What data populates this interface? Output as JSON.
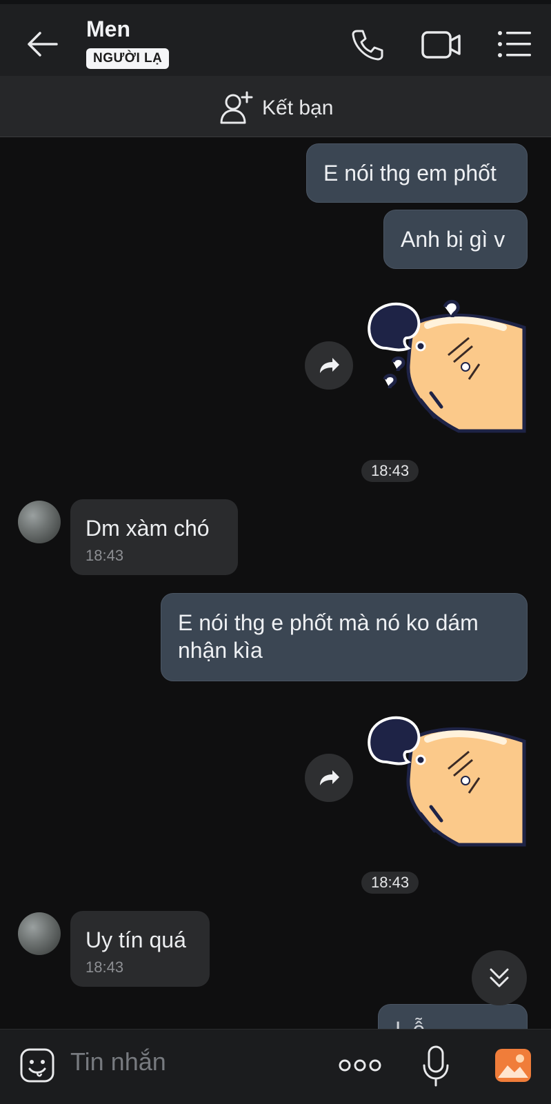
{
  "header": {
    "title": "Men",
    "badge": "NGƯỜI LẠ"
  },
  "friend_bar": {
    "label": "Kết bạn"
  },
  "messages": [
    {
      "side": "out",
      "text": "E nói thg em phốt"
    },
    {
      "side": "out",
      "text": "Anh bị gì v"
    },
    {
      "side": "out",
      "type": "sticker"
    },
    {
      "timestamp": "18:43"
    },
    {
      "side": "in",
      "text": "Dm xàm chó",
      "time": "18:43"
    },
    {
      "side": "out",
      "text": "E nói thg e phốt mà nó ko dám nhận kìa"
    },
    {
      "side": "out",
      "type": "sticker"
    },
    {
      "timestamp": "18:43"
    },
    {
      "side": "in",
      "text": "Uy tín quá",
      "time": "18:43"
    },
    {
      "side": "out",
      "text": "L    ễ",
      "partial": true
    }
  ],
  "composer": {
    "placeholder": "Tin nhắn"
  },
  "icons": [
    "back-arrow-icon",
    "phone-icon",
    "video-camera-icon",
    "list-menu-icon",
    "add-friend-icon",
    "share-forward-icon",
    "chevron-double-down-icon",
    "emoji-icon",
    "more-dots-icon",
    "microphone-icon",
    "image-icon"
  ],
  "colors": {
    "background": "#0f0f10",
    "outgoing_bubble": "#3b4653",
    "incoming_bubble": "#2a2b2d",
    "header": "#1e1f21",
    "accent_photo": "#f07d3a"
  }
}
